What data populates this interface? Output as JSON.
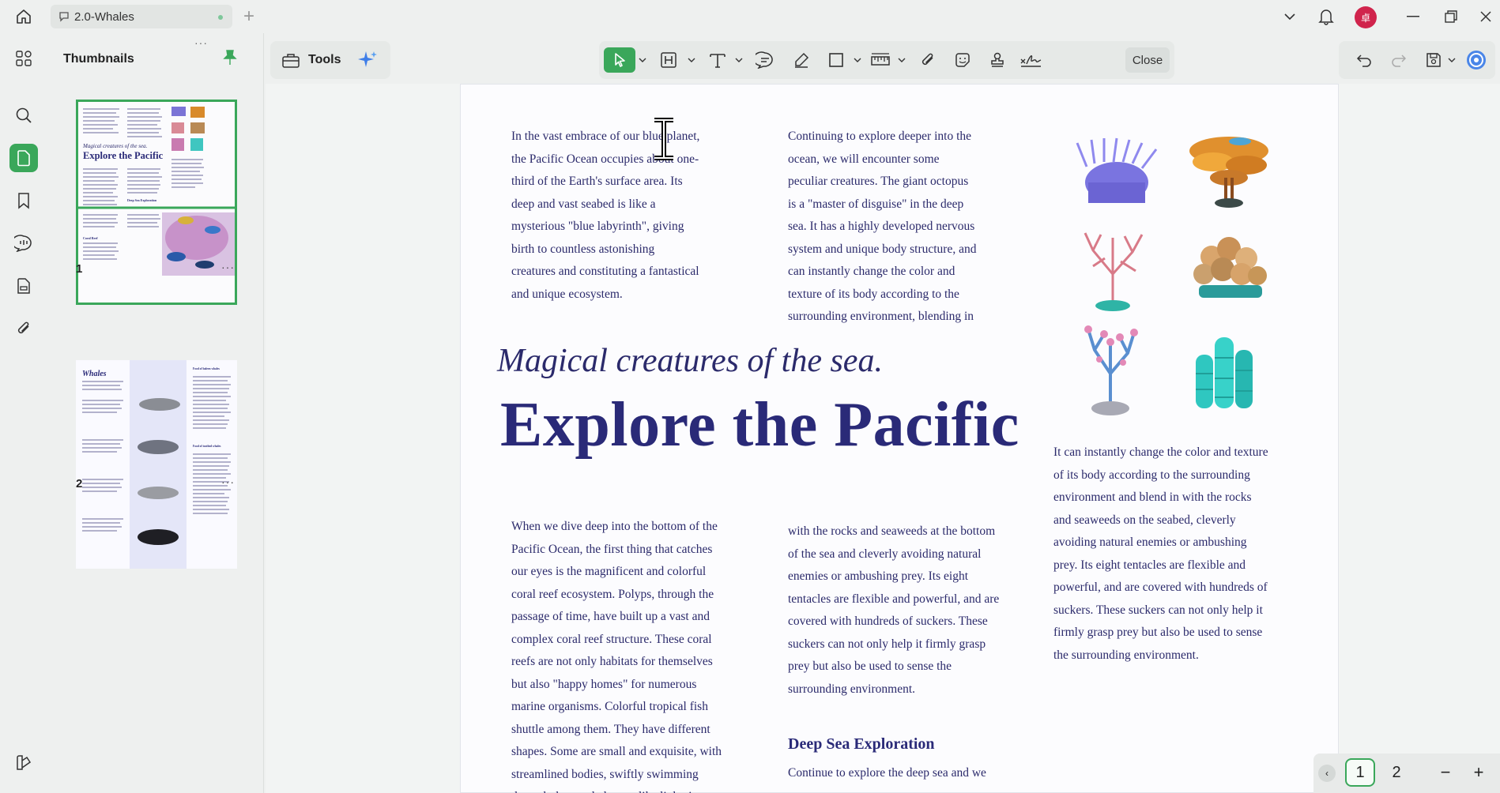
{
  "tab": {
    "title": "2.0-Whales"
  },
  "avatar": {
    "initial": "卓"
  },
  "sidebar": {
    "title": "Thumbnails",
    "pages": [
      {
        "num": "1"
      },
      {
        "num": "2"
      }
    ],
    "more": "···"
  },
  "toolbar": {
    "tools_label": "Tools",
    "close_label": "Close"
  },
  "document": {
    "col1_top": "In the vast embrace of our blue planet, the Pacific Ocean occupies about one-third of the Earth's surface area. Its deep and vast seabed is like a mysterious \"blue labyrinth\", giving birth to countless astonishing creatures and constituting a fantastical and unique ecosystem.",
    "col2_top": "Continuing to explore deeper into the ocean, we will encounter some peculiar creatures. The giant octopus is a \"master of disguise\" in the deep sea. It has a highly developed nervous system and unique body structure, and can instantly change the color and texture of its body according to the surrounding environment, blending in",
    "subtitle": "Magical creatures of the sea.",
    "title": "Explore the Pacific",
    "col3_mid": "It can instantly change the color and texture of its body according to the surrounding environment and blend in with the rocks and seaweeds on the seabed, cleverly avoiding natural enemies or ambushing prey. Its eight tentacles are flexible and powerful, and are covered with hundreds of suckers. These suckers can not only help it firmly grasp prey but also be used to sense the surrounding environment.",
    "col1_bottom": "When we dive deep into the bottom of the Pacific Ocean, the first thing that catches our eyes is the magnificent and colorful coral reef ecosystem. Polyps, through the passage of time, have built up a vast and complex coral reef structure. These coral reefs are not only habitats for themselves but also \"happy homes\" for numerous marine organisms. Colorful tropical fish shuttle among them. They have different shapes. Some are small and exquisite, with streamlined bodies, swiftly swimming through the coral clusters like lightning",
    "col2_bottom": "with the rocks and seaweeds at the bottom of the sea and cleverly avoiding natural enemies or ambushing prey. Its eight tentacles are flexible and powerful, and are covered with hundreds of suckers. These suckers can not only help it firmly grasp prey but also be used to sense the surrounding environment.",
    "heading_deep": "Deep Sea Exploration",
    "col2_deep": "Continue to explore the deep sea and we"
  },
  "thumb1": {
    "subtitle": "Magical creatures of the sea.",
    "title": "Explore the Pacific",
    "section": "Coral Reef",
    "deep": "Deep Sea Exploration"
  },
  "thumb2": {
    "title": "Whales",
    "heading_a": "Food of baleen whales",
    "heading_b": "Food of toothed whales"
  },
  "pagenav": {
    "page1": "1",
    "page2": "2",
    "minus": "−",
    "plus": "+"
  },
  "colors": {
    "accent": "#3aa75a",
    "text": "#2b2a6b",
    "avatar": "#d0244c"
  }
}
